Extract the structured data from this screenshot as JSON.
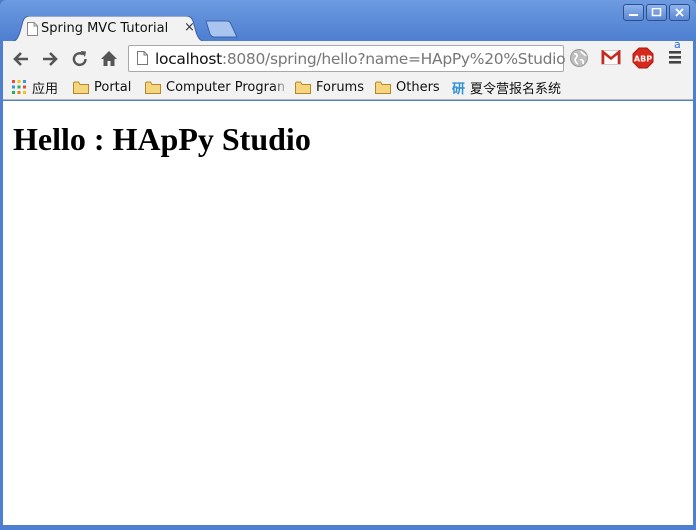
{
  "window": {
    "controls": [
      "minimize",
      "maximize",
      "close"
    ]
  },
  "tab": {
    "title": "Spring MVC Tutorial",
    "close_glyph": "×"
  },
  "toolbar": {
    "url_host": "localhost",
    "url_rest": ":8080/spring/hello?name=HApPy%20%Studio"
  },
  "bookmarks": {
    "apps_label": "应用",
    "items": [
      {
        "label": "Portal",
        "icon": "folder-icon"
      },
      {
        "label": "Computer Program",
        "icon": "folder-icon"
      },
      {
        "label": "Forums",
        "icon": "folder-icon"
      },
      {
        "label": "Others",
        "icon": "folder-icon"
      },
      {
        "label": "夏令营报名系统",
        "icon": "yan-favicon-icon"
      }
    ],
    "yan_glyph": "研"
  },
  "page": {
    "heading": "Hello : HApPy Studio"
  },
  "colors": {
    "frame": "#4e7fd1",
    "toolbar": "#f2f2f2",
    "abp_red": "#d9291c",
    "gmail_red": "#c8281e"
  }
}
